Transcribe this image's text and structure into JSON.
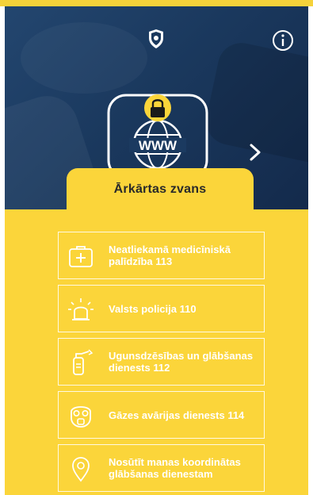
{
  "colors": {
    "accent_yellow": "#fbd53a",
    "hero_blue": "#1b3a60",
    "text_dark": "#2a2a2a",
    "text_light": "#ffffff"
  },
  "header": {
    "logo_icon": "police-shield-icon",
    "info_icon": "info-icon"
  },
  "hero": {
    "illustration_icon": "secure-www-globe-icon",
    "next_icon": "chevron-right-icon"
  },
  "panel": {
    "title": "Ārkārtas zvans"
  },
  "services": [
    {
      "icon": "medical-kit-icon",
      "label": "Neatliekamā medicīniskā palīdzība 113"
    },
    {
      "icon": "police-siren-icon",
      "label": "Valsts policija 110"
    },
    {
      "icon": "fire-extinguisher-icon",
      "label": "Ugunsdzēsības un glābšanas dienests 112"
    },
    {
      "icon": "gas-mask-icon",
      "label": "Gāzes avārijas dienests 114"
    },
    {
      "icon": "location-pin-icon",
      "label": "Nosūtīt manas koordinātas glābšanas dienestam"
    }
  ]
}
